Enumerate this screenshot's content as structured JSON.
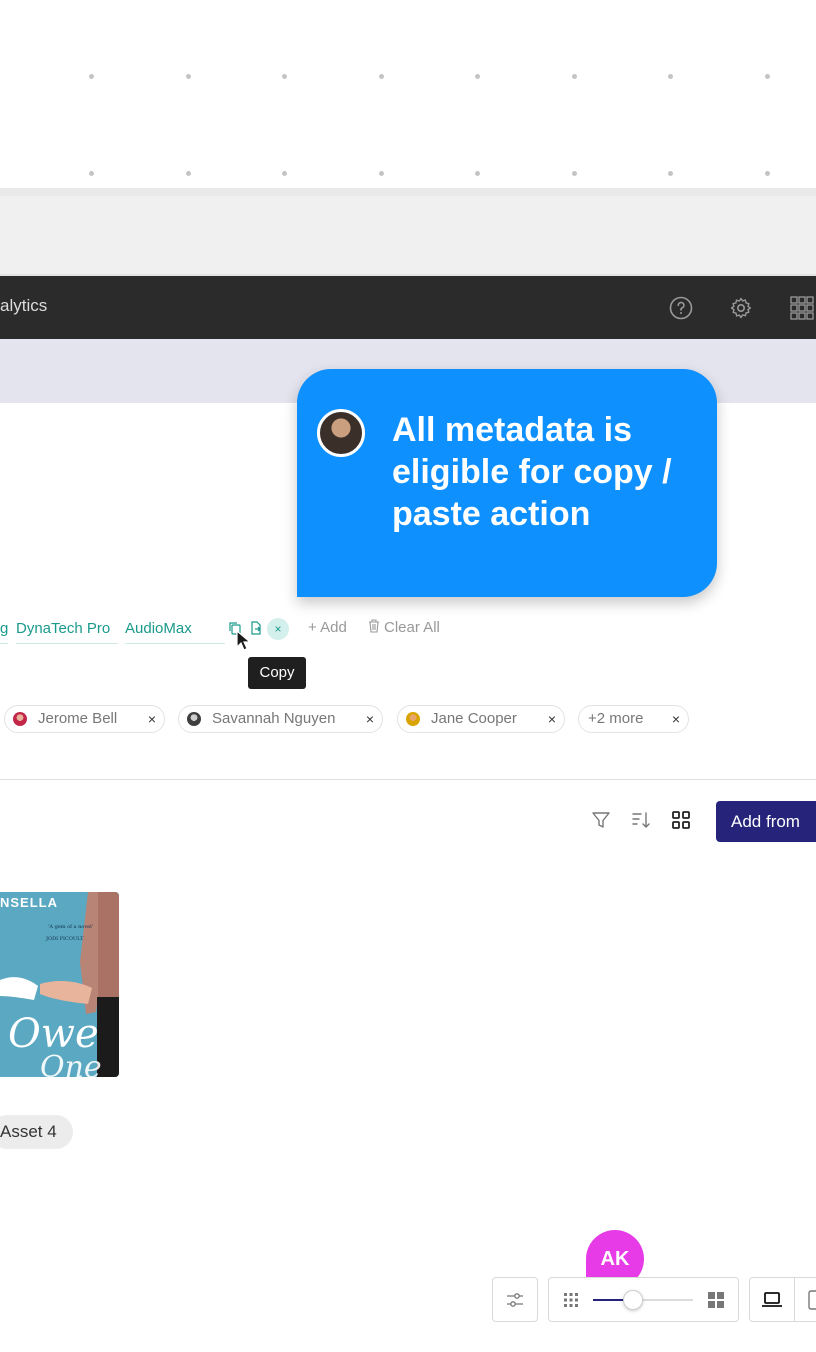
{
  "topbar": {
    "title": "alytics",
    "icons": [
      "help-circle-icon",
      "gear-icon",
      "apps-grid-icon"
    ]
  },
  "bubble": {
    "message": "All metadata is eligible for copy / paste action"
  },
  "tags": {
    "items": [
      "g",
      "DynaTech Pro",
      "AudioMax"
    ],
    "add_label": "+ Add",
    "clear_label": "Clear All",
    "tooltip": "Copy"
  },
  "people": {
    "chips": [
      "Jerome Bell",
      "Savannah Nguyen",
      "Jane Cooper"
    ],
    "more": "+2 more",
    "remove_glyph": "×"
  },
  "toolbar": {
    "add_from_label": "Add from"
  },
  "book": {
    "title_fragment": "NSELLA"
  },
  "asset": {
    "label": "Asset 4"
  },
  "collaborator": {
    "initials": "AK"
  },
  "colors": {
    "accent": "#0f90ff",
    "brand": "#25237a",
    "tag_text": "#1b9a8c",
    "badge": "#e63be6"
  },
  "zoom": {
    "level": 0.4
  }
}
